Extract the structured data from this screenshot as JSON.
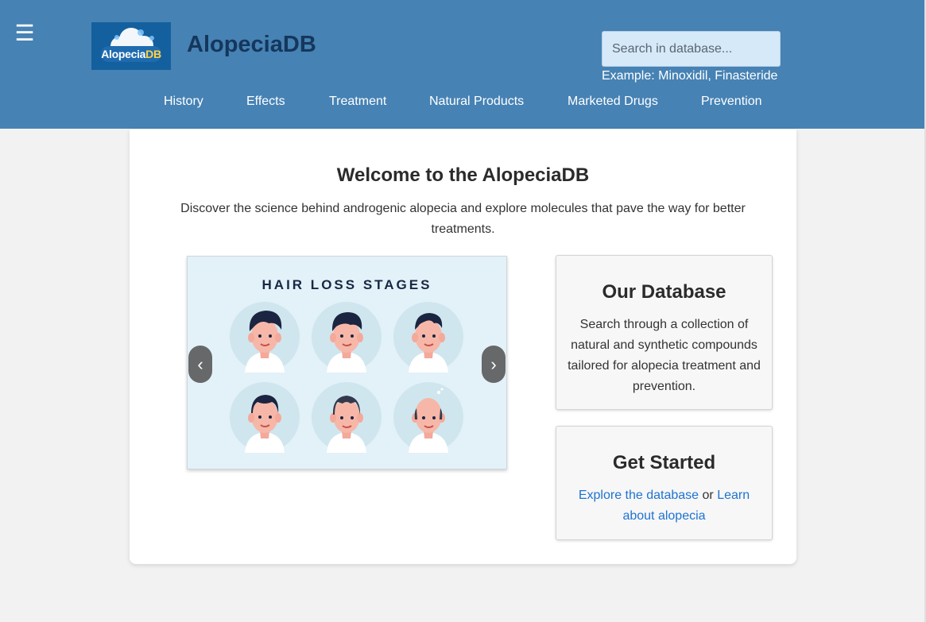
{
  "header": {
    "menu_icon": "hamburger-menu-icon",
    "logo": {
      "text_main": "Alopecia",
      "text_accent": "DB",
      "icon": "cloud-logo-icon"
    },
    "site_title": "AlopeciaDB",
    "search": {
      "placeholder": "Search in database...",
      "value": "",
      "example": "Example: Minoxidil, Finasteride"
    },
    "nav": [
      "History",
      "Effects",
      "Treatment",
      "Natural Products",
      "Marketed Drugs",
      "Prevention"
    ]
  },
  "main": {
    "title": "Welcome to the AlopeciaDB",
    "subtitle": "Discover the science behind androgenic alopecia and explore molecules that pave the way for better treatments.",
    "carousel": {
      "slide_title": "HAIR LOSS STAGES",
      "prev_label": "‹",
      "next_label": "›"
    },
    "database_box": {
      "title": "Our Database",
      "text": "Search through a collection of natural and synthetic compounds tailored for alopecia treatment and prevention."
    },
    "start_box": {
      "title": "Get Started",
      "link1": "Explore the database",
      "connector": " or ",
      "link2": "Learn about alopecia"
    }
  },
  "colors": {
    "header_bg": "#4682b4",
    "title_dark": "#15375c",
    "link": "#1e73d2",
    "logo_bg": "#14609f",
    "logo_accent": "#ffd23f"
  }
}
